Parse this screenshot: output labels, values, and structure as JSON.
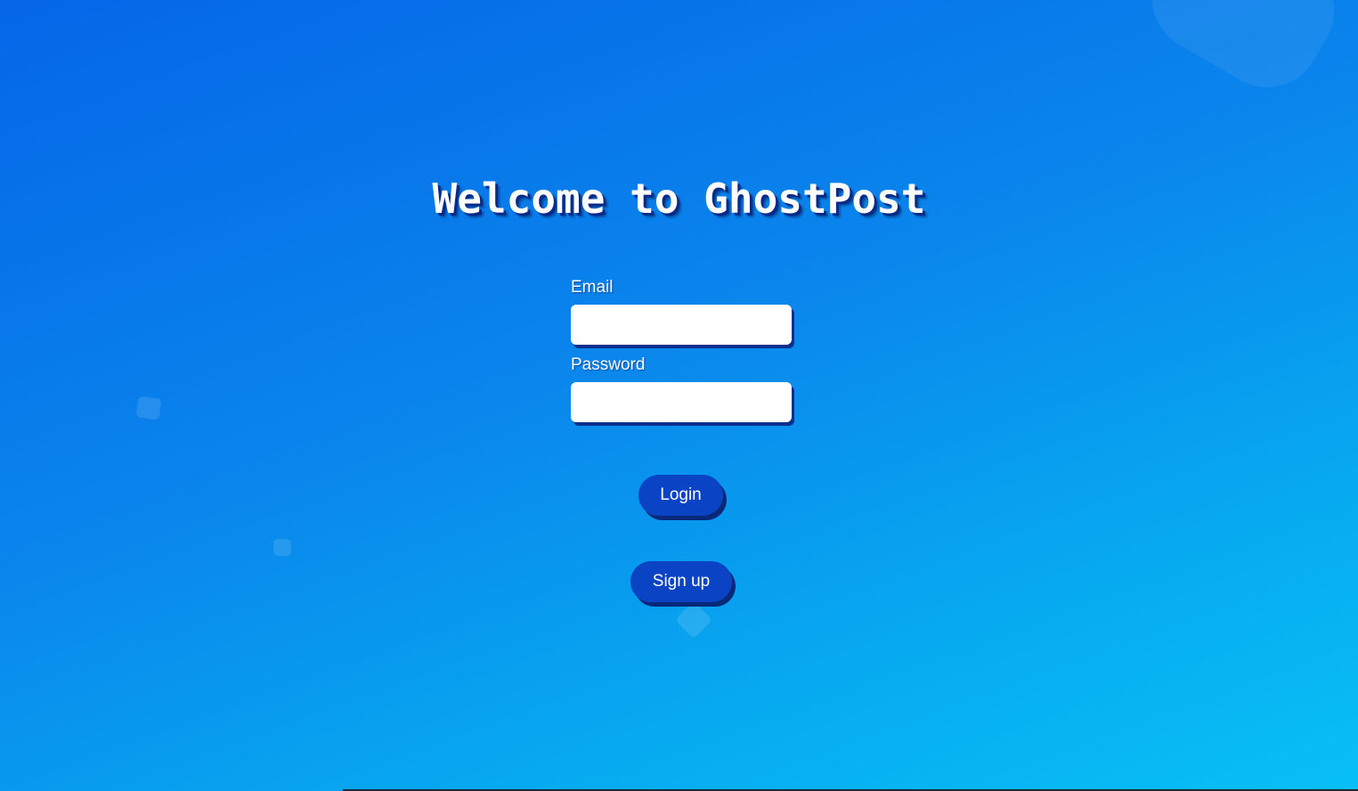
{
  "page": {
    "title": "Welcome to GhostPost"
  },
  "form": {
    "email_label": "Email",
    "email_value": "",
    "password_label": "Password",
    "password_value": ""
  },
  "buttons": {
    "login_label": "Login",
    "signup_label": "Sign up"
  },
  "colors": {
    "background_top": "#0566e8",
    "background_bottom": "#08c0f5",
    "button": "#0a44c4",
    "shadow": "#0b2f8f"
  }
}
